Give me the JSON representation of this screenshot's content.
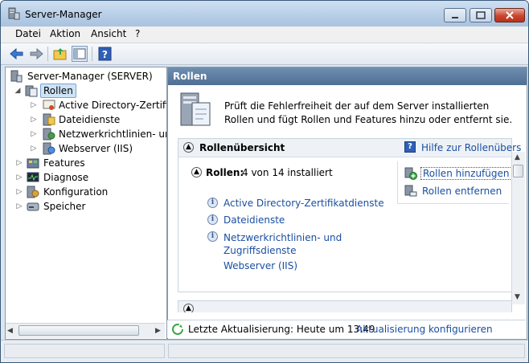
{
  "window": {
    "title": "Server-Manager"
  },
  "menu": {
    "items": [
      "Datei",
      "Aktion",
      "Ansicht",
      "?"
    ]
  },
  "tree": {
    "root": "Server-Manager (SERVER)",
    "rollen": "Rollen",
    "roles": [
      "Active Directory-Zertifika",
      "Dateidienste",
      "Netzwerkrichtlinien- und",
      "Webserver (IIS)"
    ],
    "others": [
      "Features",
      "Diagnose",
      "Konfiguration",
      "Speicher"
    ]
  },
  "right": {
    "header": "Rollen",
    "intro": "Prüft die Fehlerfreiheit der auf dem Server installierten Rollen und fügt Rollen und Features hinzu oder entfernt sie.",
    "overview_title": "Rollenübersicht",
    "help_link": "Hilfe zur Rollenübers",
    "roles_label": "Rollen:",
    "roles_count": "4 von 14 installiert",
    "installed_roles": [
      "Active Directory-Zertifikatdienste",
      "Dateidienste",
      "Netzwerkrichtlinien- und Zugriffsdienste",
      "Webserver (IIS)"
    ],
    "actions": [
      "Rollen hinzufügen",
      "Rollen entfernen"
    ]
  },
  "status": {
    "last_update": "Letzte Aktualisierung: Heute um 13:49",
    "configure_link": "Aktualisierung konfigurieren"
  }
}
